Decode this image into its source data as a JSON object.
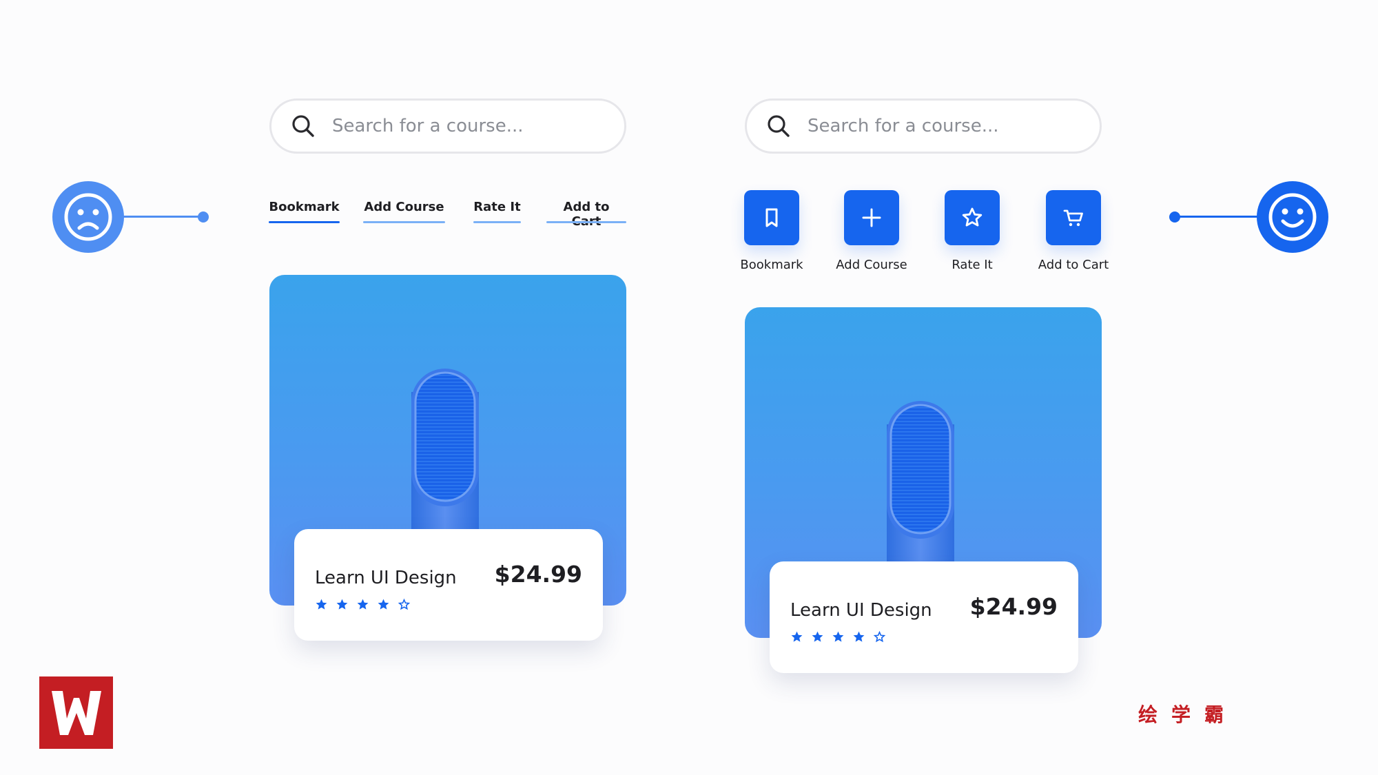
{
  "colors": {
    "accent": "#1665ee",
    "sad_mood": "#4f8ef2",
    "happy_mood": "#1665ee",
    "star": "#1665ee",
    "brand_red": "#c41e23"
  },
  "search": {
    "placeholder": "Search for a course...",
    "icon": "search-icon"
  },
  "left_variant": {
    "mood": "sad-face-icon",
    "tabs": [
      {
        "label": "Bookmark",
        "active": true
      },
      {
        "label": "Add Course",
        "active": false
      },
      {
        "label": "Rate It",
        "active": false
      },
      {
        "label": "Add to Cart",
        "active": false
      }
    ]
  },
  "right_variant": {
    "mood": "happy-face-icon",
    "actions": [
      {
        "label": "Bookmark",
        "icon": "bookmark-icon"
      },
      {
        "label": "Add Course",
        "icon": "plus-icon"
      },
      {
        "label": "Rate It",
        "icon": "star-icon"
      },
      {
        "label": "Add to Cart",
        "icon": "cart-icon"
      }
    ]
  },
  "course_card": {
    "title": "Learn UI Design",
    "price": "$24.99",
    "rating": 4,
    "rating_max": 5
  },
  "watermark": {
    "logo": "W",
    "brand_text": "绘学霸"
  }
}
